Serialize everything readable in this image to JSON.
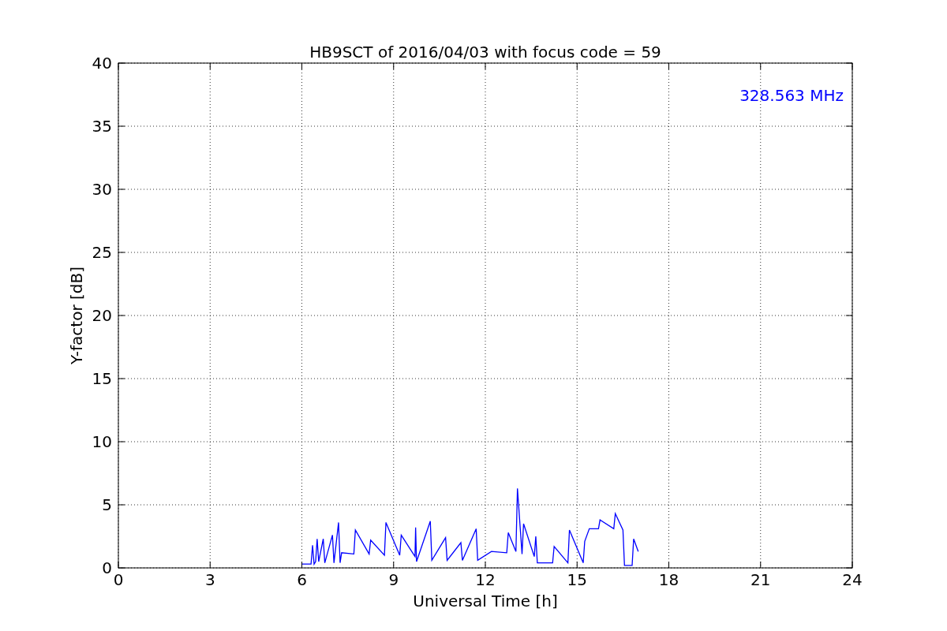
{
  "figure": {
    "chart_data": {
      "type": "line",
      "title": "HB9SCT of 2016/04/03 with focus code = 59",
      "xlabel": "Universal Time [h]",
      "ylabel": "Y-factor [dB]",
      "xlim": [
        0,
        24
      ],
      "ylim": [
        0,
        40
      ],
      "xticks": [
        0,
        3,
        6,
        9,
        12,
        15,
        18,
        21,
        24
      ],
      "yticks": [
        0,
        5,
        10,
        15,
        20,
        25,
        30,
        35,
        40
      ],
      "x": [
        6.0,
        6.3,
        6.35,
        6.4,
        6.45,
        6.5,
        6.55,
        6.7,
        6.75,
        7.0,
        7.05,
        7.2,
        7.25,
        7.3,
        7.7,
        7.75,
        8.2,
        8.25,
        8.7,
        8.75,
        9.2,
        9.25,
        9.7,
        9.72,
        9.75,
        10.2,
        10.25,
        10.7,
        10.75,
        11.2,
        11.25,
        11.7,
        11.75,
        12.2,
        12.7,
        12.75,
        13.0,
        13.05,
        13.2,
        13.25,
        13.6,
        13.65,
        13.7,
        14.2,
        14.25,
        14.7,
        14.75,
        15.2,
        15.25,
        15.4,
        15.7,
        15.75,
        16.2,
        16.25,
        16.5,
        16.55,
        16.8,
        16.85,
        17.0
      ],
      "grid": true,
      "series": [
        {
          "color": "#0000ff",
          "values": [
            0.3,
            0.3,
            1.8,
            0.3,
            0.5,
            2.3,
            0.5,
            2.3,
            0.4,
            2.6,
            0.4,
            3.6,
            0.4,
            1.2,
            1.1,
            3.0,
            1.1,
            2.2,
            1.0,
            3.6,
            1.0,
            2.6,
            0.9,
            3.2,
            0.5,
            3.7,
            0.6,
            2.4,
            0.6,
            2.0,
            0.6,
            3.1,
            0.6,
            1.3,
            1.2,
            2.8,
            1.3,
            6.3,
            1.1,
            3.5,
            0.9,
            2.5,
            0.4,
            0.4,
            1.7,
            0.4,
            3.0,
            0.4,
            2.1,
            3.1,
            3.1,
            3.8,
            3.1,
            4.3,
            3.0,
            0.2,
            0.2,
            2.3,
            1.3
          ]
        }
      ],
      "annotations": [
        "328.563 MHz"
      ]
    }
  }
}
